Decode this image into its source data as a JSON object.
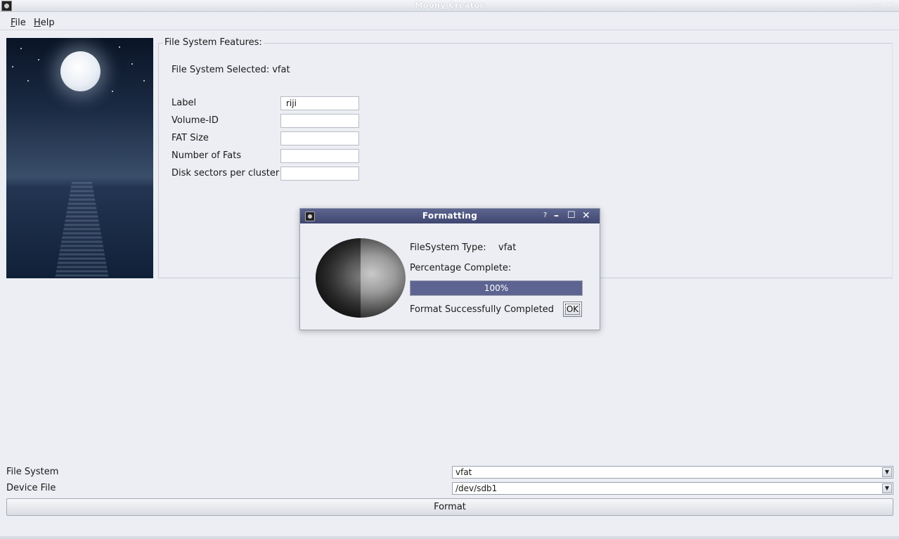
{
  "window": {
    "title": "Moony Creator"
  },
  "menubar": {
    "file_prefix": "F",
    "file_rest": "ile",
    "help_prefix": "H",
    "help_rest": "elp"
  },
  "features": {
    "legend": "File System Features:",
    "selected_label": "File System Selected:",
    "selected_value": "vfat",
    "fields": [
      {
        "label": "Label",
        "value": "riji"
      },
      {
        "label": "Volume-ID",
        "value": ""
      },
      {
        "label": "FAT Size",
        "value": ""
      },
      {
        "label": "Number of Fats",
        "value": ""
      },
      {
        "label": "Disk sectors per cluster",
        "value": ""
      }
    ]
  },
  "dialog": {
    "title": "Formatting",
    "help_glyph": "?",
    "fs_type_label": "FileSystem Type:",
    "fs_type_value": "vfat",
    "percent_label": "Percentage Complete:",
    "progress_value": 1.0,
    "progress_text": "100%",
    "status": "Format Successfully Completed",
    "ok_label": "OK"
  },
  "bottom": {
    "file_system_label": "File System",
    "file_system_value": "vfat",
    "device_label": "Device File",
    "device_value": "/dev/sdb1",
    "format_label": "Format"
  },
  "colors": {
    "dialog_titlebar": "#4a5280",
    "progress_fill": "#5e6491",
    "background": "#eceef3"
  }
}
